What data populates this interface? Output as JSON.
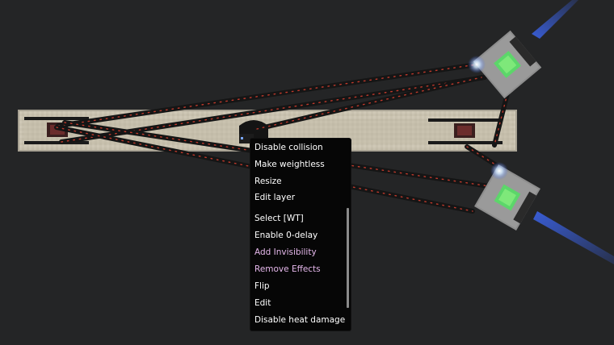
{
  "scene": {
    "background": "#242526",
    "beam_color": "#3b63e8",
    "glow_color": "#cfe6ff",
    "cable_marker_color": "#c0392b",
    "emitter_core_color": "#7ee87a",
    "objects": [
      "concrete-beam",
      "laser-emitter",
      "laser-emitter",
      "cable",
      "cable",
      "cable",
      "cable",
      "cable"
    ]
  },
  "context_menu": {
    "items": [
      {
        "label": "Disable collision",
        "style": "normal"
      },
      {
        "label": "Make weightless",
        "style": "normal"
      },
      {
        "label": "Resize",
        "style": "normal"
      },
      {
        "label": "Edit layer",
        "style": "normal"
      },
      {
        "label": "Select [WT]",
        "style": "normal"
      },
      {
        "label": "Enable 0-delay",
        "style": "normal"
      },
      {
        "label": "Add Invisibility",
        "style": "effect"
      },
      {
        "label": "Remove Effects",
        "style": "effect"
      },
      {
        "label": "Flip",
        "style": "normal"
      },
      {
        "label": "Edit",
        "style": "normal"
      },
      {
        "label": "Disable heat damage",
        "style": "normal"
      }
    ]
  }
}
